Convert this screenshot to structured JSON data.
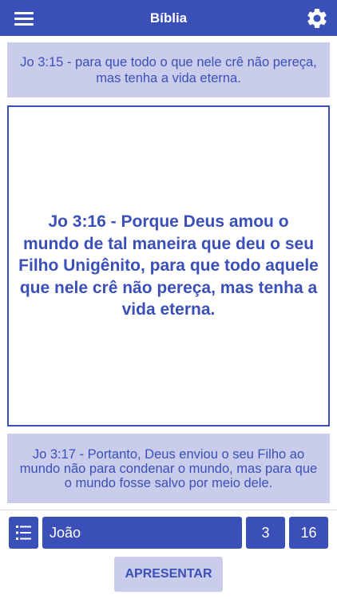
{
  "appbar": {
    "title": "Bíblia",
    "menu_icon": "menu-icon",
    "settings_icon": "gear-icon"
  },
  "verses": {
    "previous": "Jo 3:15 - para que todo o que nele crê não pereça, mas tenha a vida eterna.",
    "current": "Jo 3:16 - Porque Deus amou o mundo de tal maneira que deu o seu Filho Unigênito, para que todo aquele que nele crê não pereça, mas tenha a vida eterna.",
    "next": "Jo 3:17 - Portanto, Deus enviou o seu Filho ao mundo não para condenar o mundo, mas para que o mundo fosse salvo por meio dele."
  },
  "selector": {
    "list_icon": "list-icon",
    "book": "João",
    "chapter": "3",
    "verse": "16"
  },
  "actions": {
    "present_label": "APRESENTAR"
  },
  "colors": {
    "primary": "#3b4fb8",
    "light": "#c9cdeb",
    "background": "#ffffff"
  }
}
